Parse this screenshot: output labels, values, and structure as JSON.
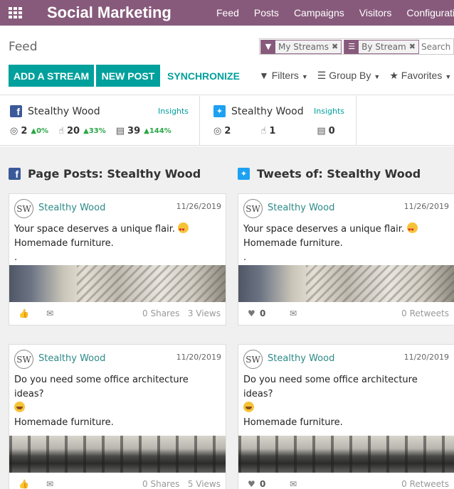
{
  "app": {
    "title": "Social Marketing",
    "menu": [
      "Feed",
      "Posts",
      "Campaigns",
      "Visitors",
      "Configurati"
    ]
  },
  "control": {
    "breadcrumb": "Feed",
    "facets": [
      {
        "icon": "filter-icon",
        "label": "My Streams"
      },
      {
        "icon": "group-icon",
        "label": "By Stream"
      }
    ],
    "search_placeholder": "Search",
    "buttons": {
      "add_stream": "ADD A STREAM",
      "new_post": "NEW POST",
      "synchronize": "SYNCHRONIZE"
    },
    "filters": {
      "filters": "Filters",
      "group_by": "Group By",
      "favorites": "Favorites"
    }
  },
  "accounts": [
    {
      "network": "facebook",
      "name": "Stealthy Wood",
      "insights": "Insights",
      "stats": [
        {
          "icon": "reach-icon",
          "value": "2",
          "trend": "0%"
        },
        {
          "icon": "engagement-icon",
          "value": "20",
          "trend": "33%"
        },
        {
          "icon": "stories-icon",
          "value": "39",
          "trend": "144%"
        }
      ]
    },
    {
      "network": "twitter",
      "name": "Stealthy Wood",
      "insights": "Insights",
      "stats": [
        {
          "icon": "reach-icon",
          "value": "2",
          "trend": ""
        },
        {
          "icon": "engagement-icon",
          "value": "1",
          "trend": ""
        },
        {
          "icon": "stories-icon",
          "value": "0",
          "trend": ""
        }
      ]
    }
  ],
  "streams": [
    {
      "network": "facebook",
      "title": "Page Posts: Stealthy Wood",
      "posts": [
        {
          "author": "Stealthy Wood",
          "date": "11/26/2019",
          "line1": "Your space deserves a unique flair.",
          "emoji": "heart-eyes",
          "line2": "Homemade furniture.",
          "line3": ".",
          "image": "room",
          "shares": "0 Shares",
          "views": "3 Views"
        },
        {
          "author": "Stealthy Wood",
          "date": "11/20/2019",
          "line1": "Do you need some office architecture ideas?",
          "emoji": "grin",
          "line2": "Homemade furniture.",
          "image": "office",
          "shares": "0 Shares",
          "views": "5 Views"
        }
      ]
    },
    {
      "network": "twitter",
      "title": "Tweets of: Stealthy Wood",
      "posts": [
        {
          "author": "Stealthy Wood",
          "date": "11/26/2019",
          "line1": "Your space deserves a unique flair.",
          "emoji": "heart-eyes",
          "line2": "Homemade furniture.",
          "line3": ".",
          "image": "room",
          "likes": "0",
          "retweets": "0 Retweets"
        },
        {
          "author": "Stealthy Wood",
          "date": "11/20/2019",
          "line1": "Do you need some office architecture ideas?",
          "emoji": "grin",
          "line2": "Homemade furniture.",
          "image": "office",
          "likes": "0",
          "retweets": "0 Retweets"
        }
      ]
    }
  ],
  "colors": {
    "brand": "#875A7B",
    "accent": "#00A09D",
    "positive": "#28a745",
    "facebook": "#3b5998",
    "twitter": "#1da1f2"
  }
}
